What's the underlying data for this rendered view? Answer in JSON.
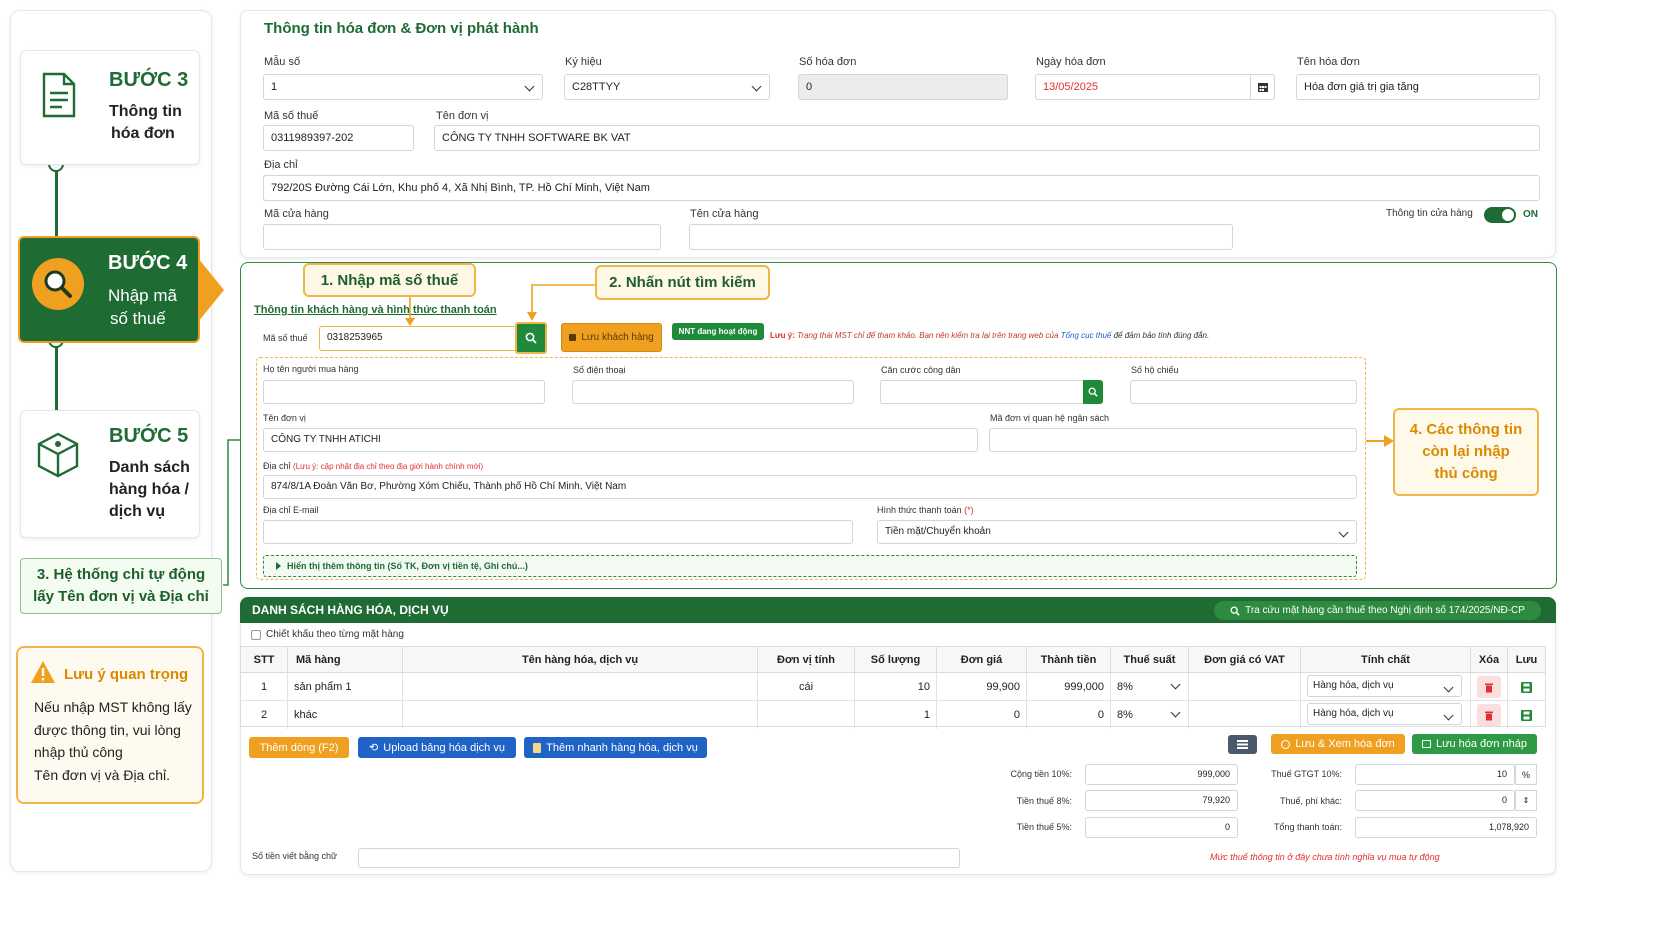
{
  "steps": [
    {
      "title": "BƯỚC 3",
      "line1": "Thông tin",
      "line2": "hóa đơn",
      "icon": "document-icon"
    },
    {
      "title": "BƯỚC 4",
      "line1": "Nhập mã",
      "line2": "số thuế",
      "icon": "search-icon"
    },
    {
      "title": "BƯỚC 5",
      "line1": "Danh sách",
      "line2": "hàng hóa /",
      "line3": "dịch vụ",
      "icon": "box-icon"
    }
  ],
  "callouts": {
    "c1": "1. Nhập mã số thuế",
    "c2": "2. Nhấn nút tìm kiếm",
    "c3_l1": "3. Hệ thống chỉ tự động",
    "c3_l2": "lấy Tên đơn vị và Địa chỉ",
    "c4_l1": "4. Các thông tin",
    "c4_l2": "còn lại nhập",
    "c4_l3": "thủ công"
  },
  "note": {
    "title": "Lưu ý quan trọng",
    "l1": "Nếu nhập MST không lấy",
    "l2": "được thông tin, vui lòng",
    "l3": "nhập thủ công",
    "l4": "Tên đơn vị và Địa chỉ."
  },
  "invoice": {
    "heading": "Thông tin hóa đơn & Đơn vị phát hành",
    "mau_so_label": "Mẫu số",
    "mau_so": "1",
    "ky_hieu_label": "Ký hiệu",
    "ky_hieu": "C28TTYY",
    "so_hd_label": "Số hóa đơn",
    "so_hd": "0",
    "ngay_label": "Ngày hóa đơn",
    "ngay": "13/05/2025",
    "ten_hd_label": "Tên hóa đơn",
    "ten_hd": "Hóa đơn giá trị gia tăng",
    "mst_label": "Mã số thuế",
    "mst": "0311989397-202",
    "ten_dv_label": "Tên đơn vị",
    "ten_dv": "CÔNG TY TNHH SOFTWARE BK VAT",
    "dia_chi_label": "Địa chỉ",
    "dia_chi": "792/20S Đường Cái Lớn, Khu phố 4, Xã Nhị Bình, TP. Hồ Chí Minh, Việt Nam",
    "ma_ch_label": "Mã cửa hàng",
    "ten_ch_label": "Tên cửa hàng",
    "toggle_label": "Thông tin cửa hàng",
    "toggle_state": "ON"
  },
  "customer": {
    "heading": "Thông tin khách hàng và hình thức thanh toán",
    "mst_label": "Mã số thuế",
    "mst": "0318253965",
    "save_btn": "Lưu khách hàng",
    "status_badge": "NNT đang hoạt động",
    "note_prefix": "Lưu ý:",
    "note_italic": " Trạng thái MST chỉ để tham khảo. Bạn nên kiểm tra lại trên trang web của ",
    "note_link": "Tổng cục thuế",
    "note_suffix": " để đảm bảo tính đúng đắn.",
    "buyer_label": "Họ tên người mua hàng",
    "phone_label": "Số điện thoại",
    "cccd_label": "Căn cước công dân",
    "passport_label": "Số hộ chiếu",
    "unit_label": "Tên đơn vị",
    "unit": "CÔNG TY TNHH ATICHI",
    "budget_label": "Mã đơn vị quan hệ ngân sách",
    "addr_label": "Địa chỉ",
    "addr_note": "(Lưu ý: cập nhật địa chỉ theo địa giới hành chính mới)",
    "addr": "874/8/1A Đoàn Văn Bơ, Phường Xóm Chiếu, Thành phố Hồ Chí Minh, Việt Nam",
    "email_label": "Địa chỉ E-mail",
    "pay_label": "Hình thức thanh toán",
    "pay_req": "(*)",
    "pay": "Tiền mặt/Chuyển khoản",
    "more_info": "Hiển thị thêm thông tin (Số TK, Đơn vị tiền tệ, Ghi chú...)"
  },
  "goods": {
    "heading": "DANH SÁCH HÀNG HÓA, DỊCH VỤ",
    "lookup_btn": "Tra cứu mặt hàng cần thuế theo Nghị định số 174/2025/NĐ-CP",
    "discount_label": "Chiết khấu theo từng mặt hàng",
    "columns": [
      "STT",
      "Mã hàng",
      "Tên hàng hóa, dịch vụ",
      "Đơn vị tính",
      "Số lượng",
      "Đơn giá",
      "Thành tiền",
      "Thuế suất",
      "Đơn giá có VAT",
      "Tính chất",
      "Xóa",
      "Lưu"
    ],
    "rows": [
      {
        "stt": "1",
        "ma": "sản phẩm 1",
        "ten": "",
        "dvt": "cái",
        "sl": "10",
        "dg": "99,900",
        "tt": "999,000",
        "ts": "8%",
        "dgvat": "",
        "tc": "Hàng hóa, dịch vụ"
      },
      {
        "stt": "2",
        "ma": "khác",
        "ten": "",
        "dvt": "",
        "sl": "1",
        "dg": "0",
        "tt": "0",
        "ts": "8%",
        "dgvat": "",
        "tc": "Hàng hóa, dịch vụ"
      }
    ],
    "add_row": "Thêm dòng (F2)",
    "upload": "Upload bảng hóa dịch vụ",
    "quick_add": "Thêm nhanh hàng hóa, dịch vụ",
    "save_view": "Lưu & Xem hóa đơn",
    "save_draft": "Lưu hóa đơn nháp"
  },
  "totals": {
    "cong_tien_label": "Cộng tiền 10%:",
    "cong_tien": "999,000",
    "tien_thue8_label": "Tiền thuế 8%:",
    "tien_thue8": "79,920",
    "tien_thue5_label": "Tiền thuế 5%:",
    "tien_thue5": "0",
    "thue_gtgt_label": "Thuế GTGT 10%:",
    "thue_gtgt": "10",
    "thue_gtgt_unit": "%",
    "phi_khac_label": "Thuế, phí khác:",
    "phi_khac": "0",
    "tong_label": "Tổng thanh toán:",
    "tong": "1,078,920",
    "chu_label": "Số tiền viết bằng chữ",
    "warning": "Mức thuế thông tin ở đây chưa tính nghĩa vụ mua tự động"
  },
  "colors": {
    "green": "#1e6b34",
    "orange": "#f0a020",
    "blue": "#1f63c6",
    "red": "#e03030"
  }
}
